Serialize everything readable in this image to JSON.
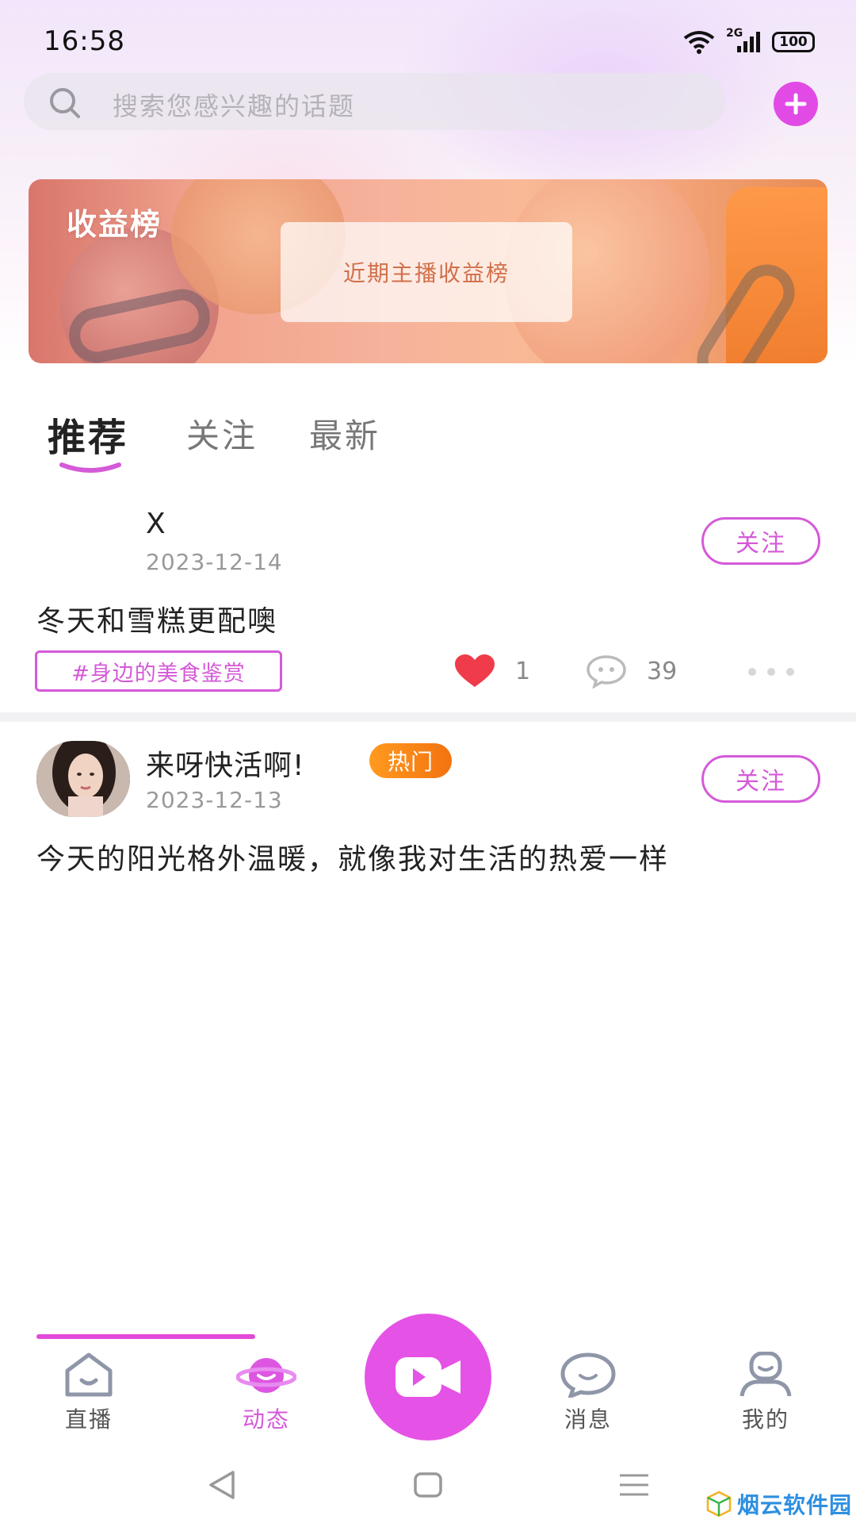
{
  "status_bar": {
    "time": "16:58",
    "network": "2G",
    "battery": "100"
  },
  "search": {
    "placeholder": "搜索您感兴趣的话题"
  },
  "banner": {
    "title": "收益榜",
    "card_text": "近期主播收益榜"
  },
  "tabs": [
    {
      "label": "推荐",
      "active": true
    },
    {
      "label": "关注",
      "active": false
    },
    {
      "label": "最新",
      "active": false
    }
  ],
  "posts": [
    {
      "username": "X",
      "date": "2023-12-14",
      "text": "冬天和雪糕更配噢",
      "follow_label": "关注",
      "tag": "#身边的美食鉴赏",
      "likes": "1",
      "comments": "39"
    },
    {
      "username": "来呀快活啊!",
      "badge": "热门",
      "date": "2023-12-13",
      "text": "今天的阳光格外温暖，就像我对生活的热爱一样",
      "follow_label": "关注"
    }
  ],
  "bottom_nav": {
    "items": [
      {
        "label": "直播",
        "icon": "home-icon",
        "active": false
      },
      {
        "label": "动态",
        "icon": "planet-icon",
        "active": true
      },
      {
        "label": "消息",
        "icon": "chat-bubble-icon",
        "active": false
      },
      {
        "label": "我的",
        "icon": "profile-icon",
        "active": false
      }
    ],
    "center_icon": "video-camera-icon"
  },
  "watermark": "烟云软件园",
  "colors": {
    "accent": "#d45ad8",
    "accent_fill": "#e552e6",
    "hot_badge": "#f37310",
    "like_heart": "#ef3b4a"
  }
}
